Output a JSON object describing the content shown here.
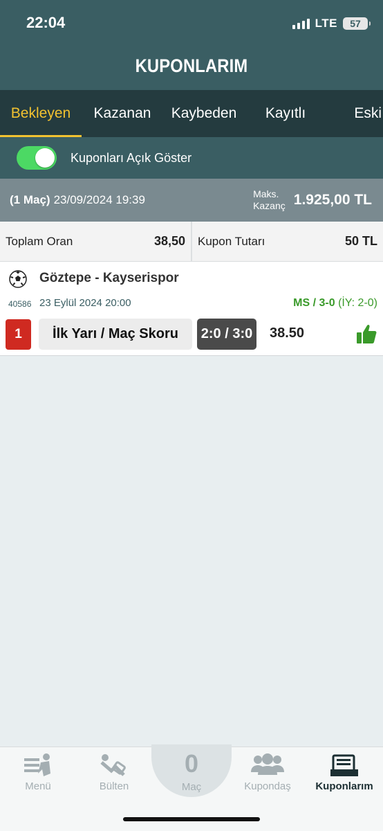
{
  "status": {
    "time": "22:04",
    "network": "LTE",
    "battery": "57"
  },
  "header": {
    "title": "KUPONLARIM"
  },
  "tabs": [
    {
      "label": "Bekleyen",
      "active": true
    },
    {
      "label": "Kazanan"
    },
    {
      "label": "Kaybeden"
    },
    {
      "label": "Kayıtlı"
    },
    {
      "label": "Eski"
    }
  ],
  "toggle": {
    "label": "Kuponları Açık Göster",
    "on": true
  },
  "coupon": {
    "count": "(1 Maç)",
    "datetime": "23/09/2024 19:39",
    "max_label_1": "Maks.",
    "max_label_2": "Kazanç",
    "max_value": "1.925,00 TL",
    "total_odds_label": "Toplam Oran",
    "total_odds": "38,50",
    "amount_label": "Kupon Tutarı",
    "amount": "50 TL"
  },
  "match": {
    "teams": "Göztepe - Kayserispor",
    "code": "40586",
    "date": "23 Eylül 2024 20:00",
    "result_main": "MS / 3-0",
    "result_half": "(İY: 2-0)",
    "pick_number": "1",
    "bet_type": "İlk Yarı / Maç Skoru",
    "bet_pick": "2:0 / 3:0",
    "odd": "38.50"
  },
  "bottom_nav": {
    "menu": "Menü",
    "bulletin": "Bülten",
    "match_count": "0",
    "match_label": "Maç",
    "share": "Kupondaş",
    "coupons": "Kuponlarım"
  },
  "colors": {
    "header_bg": "#3a5e63",
    "tabs_bg": "#243b3f",
    "accent_yellow": "#f2c230",
    "toggle_green": "#4cd964",
    "win_green": "#3a9a2a",
    "pick_red": "#cf2a21"
  }
}
